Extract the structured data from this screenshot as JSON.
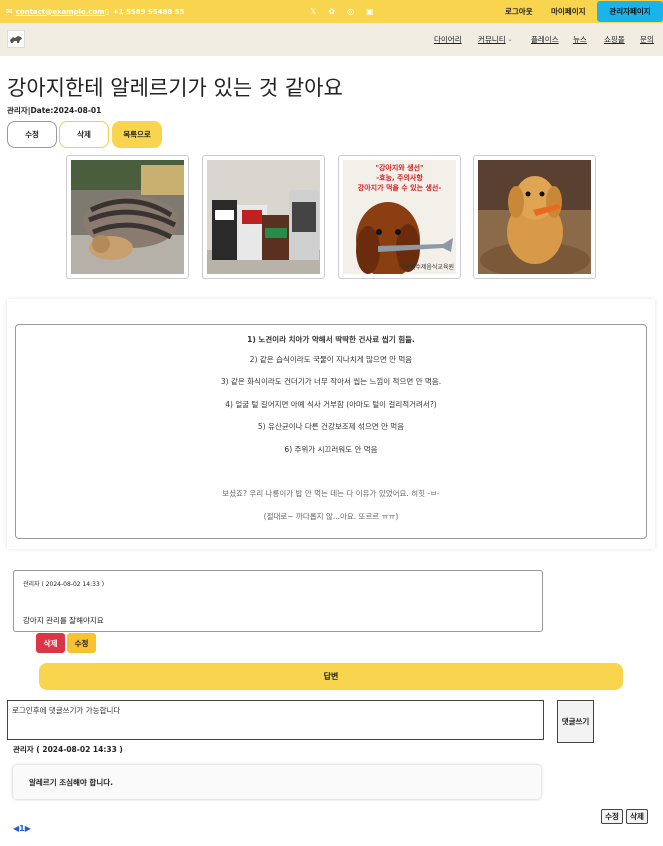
{
  "topbar": {
    "email": "contact@example.com",
    "phone": "+1 5589 55488 55",
    "logout": "로그아웃",
    "mypage": "마이페이지",
    "admin": "관리자페이지"
  },
  "nav": {
    "diary": "다이어리",
    "community": "커뮤니티",
    "places": "플레이스",
    "news": "뉴스",
    "shopping": "쇼핑몰",
    "contact": "문의"
  },
  "post": {
    "title": "강아지한테 알레르기가 있는 것 같아요",
    "meta": "관리자|Date:2024-08-01",
    "edit": "수정",
    "delete": "삭제",
    "list": "목록으로",
    "photo3_caption_1": "\"강아지와 생선\"",
    "photo3_caption_2": "-효능, 주의사항",
    "photo3_caption_3": "강아지가 먹을 수 있는 생선-",
    "photo3_footer": "한국펫수제음식교육원",
    "lines": [
      "1) 노견이라 치아가 약해서 딱딱한 건사료 씹기 힘듦.",
      "2) 같은 습식이라도 국물이 지나치게 많으면 안 먹음",
      "3) 같은 화식이라도 건더기가 너무 작아서 씹는 느낌이 적으면 안 먹음.",
      "4) 얼굴 털 길어지면 아예 식사 거부함 (아마도 털이 걸리적거려서?)",
      "5) 유산균이나 다른 건강보조제 섞으면 안 먹음",
      "6) 주위가 시끄러워도 안 먹음",
      "보셨죠? 우리 나롱이가 밥 안 먹는 데는 다 이유가 있었어요. 히힛 -ㅂ-",
      "(절대로~ 까다롭지 않...아요. 또르르 ㅠㅠ)"
    ]
  },
  "comment": {
    "author": "관리자 ( 2024-08-02 14:33 )",
    "text": "강아지 관리를 잘해야지요",
    "delete": "삭제",
    "edit": "수정",
    "reply": "답변"
  },
  "write": {
    "placeholder": "로그인후에 댓글쓰기가 가능합니다",
    "button": "댓글쓰기"
  },
  "reply": {
    "author": "관리자 ( 2024-08-02 14:33 )",
    "text": "알레르기 조심해야 합니다.",
    "edit": "수정",
    "delete": "삭제"
  },
  "pager": "◀1▶"
}
